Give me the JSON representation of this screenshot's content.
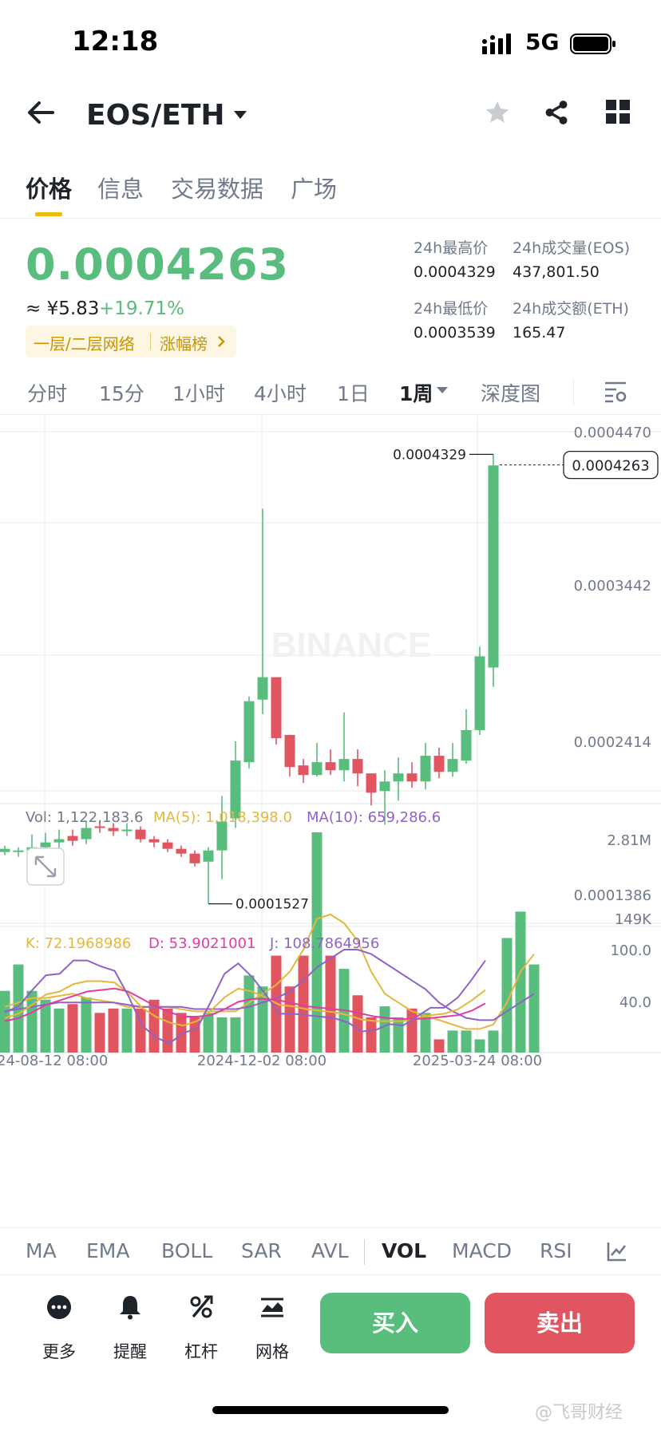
{
  "status_bar": {
    "time": "12:18",
    "network": "5G"
  },
  "header": {
    "pair": "EOS/ETH"
  },
  "tabs": [
    "价格",
    "信息",
    "交易数据",
    "广场"
  ],
  "ticker": {
    "last_price": "0.0004263",
    "cny_value": "≈ ¥5.83",
    "change": "+19.71%",
    "tag_left": "一层/二层网络",
    "tag_right": "涨幅榜",
    "high_label": "24h最高价",
    "high_value": "0.0004329",
    "vol_label": "24h成交量(EOS)",
    "vol_value": "437,801.50",
    "low_label": "24h最低价",
    "low_value": "0.0003539",
    "amt_label": "24h成交额(ETH)",
    "amt_value": "165.47"
  },
  "intervals": [
    "分时",
    "15分",
    "1小时",
    "4小时",
    "1日",
    "1周",
    "深度图"
  ],
  "chart_data": {
    "type": "candlestick",
    "interval": "1周",
    "price_axis": [
      "0.0004470",
      "0.0003442",
      "0.0002414",
      "0.0001386"
    ],
    "last_price_tag": "0.0004263",
    "high_marker": "0.0004329",
    "low_marker": "0.0001527",
    "watermark": "BINANCE",
    "candles": [
      [
        0.000185,
        0.000187,
        0.000183,
        0.000189
      ],
      [
        0.000185,
        0.000186,
        0.000182,
        0.000188
      ],
      [
        0.000186,
        0.000188,
        0.000182,
        0.000196
      ],
      [
        0.000188,
        0.000191,
        0.000184,
        0.000197
      ],
      [
        0.000191,
        0.000193,
        0.000187,
        0.000199
      ],
      [
        0.000195,
        0.000192,
        0.000189,
        0.000199
      ],
      [
        0.000193,
        0.0002,
        0.00019,
        0.000204
      ],
      [
        0.000201,
        0.0002,
        0.000197,
        0.000204
      ],
      [
        0.0002,
        0.000198,
        0.000195,
        0.000203
      ],
      [
        0.000198,
        0.000199,
        0.000195,
        0.000203
      ],
      [
        0.000199,
        0.000193,
        0.000191,
        0.000201
      ],
      [
        0.000193,
        0.000191,
        0.000188,
        0.000195
      ],
      [
        0.000191,
        0.000187,
        0.000185,
        0.000193
      ],
      [
        0.000187,
        0.000184,
        0.000182,
        0.000189
      ],
      [
        0.000184,
        0.000178,
        0.000176,
        0.000186
      ],
      [
        0.000179,
        0.000186,
        0.000153,
        0.000188
      ],
      [
        0.000186,
        0.000204,
        0.000168,
        0.00022
      ],
      [
        0.000206,
        0.000242,
        0.0002,
        0.000254
      ],
      [
        0.000241,
        0.000279,
        0.000237,
        0.000282
      ],
      [
        0.00028,
        0.000294,
        0.000271,
        0.000399
      ],
      [
        0.000294,
        0.000256,
        0.000252,
        0.000294
      ],
      [
        0.000258,
        0.000238,
        0.000232,
        0.000258
      ],
      [
        0.000239,
        0.000233,
        0.000228,
        0.000243
      ],
      [
        0.000233,
        0.000241,
        0.000232,
        0.000253
      ],
      [
        0.000241,
        0.000236,
        0.000233,
        0.000249
      ],
      [
        0.000236,
        0.000243,
        0.000229,
        0.000272
      ],
      [
        0.000243,
        0.000234,
        0.000226,
        0.000249
      ],
      [
        0.000234,
        0.000222,
        0.000214,
        0.000234
      ],
      [
        0.000223,
        0.000229,
        0.000202,
        0.000236
      ],
      [
        0.000229,
        0.000234,
        0.000217,
        0.000244
      ],
      [
        0.000234,
        0.000229,
        0.000225,
        0.000241
      ],
      [
        0.000229,
        0.000245,
        0.000224,
        0.000253
      ],
      [
        0.000245,
        0.000235,
        0.000231,
        0.00025
      ],
      [
        0.000235,
        0.000243,
        0.000232,
        0.000253
      ],
      [
        0.000242,
        0.000261,
        0.00024,
        0.000274
      ],
      [
        0.000261,
        0.000307,
        0.000258,
        0.000313
      ],
      [
        0.0003,
        0.000426,
        0.000288,
        0.000433
      ]
    ],
    "volume": {
      "label": "Vol: 1,122,183.6",
      "ma5_label": "MA(5): 1,018,398.0",
      "ma10_label": "MA(10): 659,286.6",
      "axis_top": "2.81M",
      "axis_bottom": "149K",
      "bars": [
        0.28,
        0.4,
        0.28,
        0.24,
        0.2,
        0.22,
        0.25,
        0.18,
        0.2,
        0.2,
        0.2,
        0.24,
        0.2,
        0.18,
        0.16,
        0.18,
        0.16,
        0.16,
        0.35,
        0.3,
        0.44,
        0.3,
        0.44,
        1.0,
        0.44,
        0.38,
        0.26,
        0.16,
        0.21,
        0.16,
        0.2,
        0.18,
        0.06,
        0.1,
        0.1,
        0.06,
        0.1,
        0.52,
        0.64,
        0.4
      ],
      "ma5": [
        0.2,
        0.22,
        0.24,
        0.24,
        0.25,
        0.26,
        0.24,
        0.23,
        0.22,
        0.2,
        0.2,
        0.2,
        0.2,
        0.19,
        0.18,
        0.18,
        0.18,
        0.18,
        0.22,
        0.26,
        0.3,
        0.36,
        0.46,
        0.6,
        0.62,
        0.58,
        0.5,
        0.36,
        0.26,
        0.22,
        0.18,
        0.16,
        0.14,
        0.12,
        0.1,
        0.1,
        0.12,
        0.22,
        0.36,
        0.44
      ],
      "ma10": [
        0.18,
        0.19,
        0.2,
        0.21,
        0.22,
        0.22,
        0.22,
        0.22,
        0.22,
        0.21,
        0.2,
        0.2,
        0.2,
        0.2,
        0.19,
        0.19,
        0.19,
        0.19,
        0.2,
        0.22,
        0.24,
        0.27,
        0.32,
        0.38,
        0.42,
        0.46,
        0.46,
        0.44,
        0.4,
        0.36,
        0.32,
        0.28,
        0.22,
        0.18,
        0.15,
        0.14,
        0.14,
        0.18,
        0.22,
        0.26
      ]
    },
    "kdj": {
      "k_label": "K: 72.1968986",
      "d_label": "D: 53.9021001",
      "j_label": "J: 108.7864956",
      "axis_top": "100.0",
      "axis_mid": "40.0",
      "k": [
        30,
        36,
        48,
        62,
        66,
        76,
        80,
        80,
        78,
        64,
        44,
        32,
        24,
        20,
        26,
        40,
        58,
        70,
        66,
        58,
        48,
        46,
        42,
        40,
        38,
        34,
        28,
        26,
        26,
        26,
        30,
        34,
        36,
        42,
        54,
        68
      ],
      "d": [
        26,
        30,
        38,
        48,
        54,
        60,
        66,
        68,
        70,
        66,
        56,
        46,
        38,
        32,
        32,
        34,
        42,
        52,
        56,
        56,
        54,
        50,
        46,
        44,
        42,
        40,
        36,
        32,
        30,
        29,
        29,
        30,
        32,
        34,
        40,
        50
      ],
      "j": [
        38,
        46,
        68,
        88,
        90,
        108,
        108,
        100,
        94,
        60,
        20,
        4,
        -4,
        10,
        16,
        52,
        90,
        104,
        86,
        62,
        36,
        36,
        34,
        32,
        30,
        24,
        12,
        14,
        22,
        20,
        32,
        44,
        44,
        58,
        82,
        108
      ]
    },
    "time_axis": [
      "24-08-12 08:00",
      "2024-12-02 08:00",
      "2025-03-24 08:00"
    ]
  },
  "indicators": [
    "MA",
    "EMA",
    "BOLL",
    "SAR",
    "AVL",
    "VOL",
    "MACD",
    "RSI"
  ],
  "actions": {
    "more": "更多",
    "alert": "提醒",
    "leverage": "杠杆",
    "grid": "网格",
    "buy": "买入",
    "sell": "卖出"
  },
  "colors": {
    "up": "#58bd7d",
    "down": "#e15561",
    "accent": "#f0b90b",
    "k": "#e5b73b",
    "d": "#e13ca4",
    "j": "#8e63c9"
  },
  "footer_watermark": "@飞哥财经"
}
